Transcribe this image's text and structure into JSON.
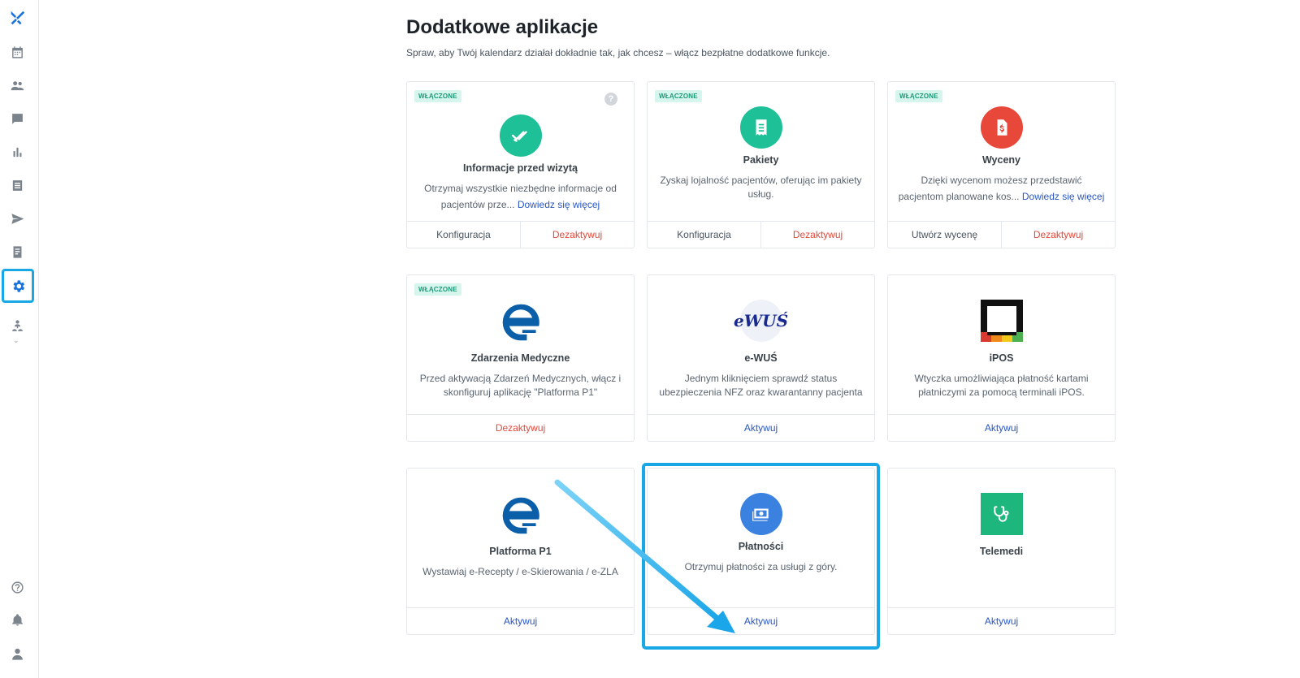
{
  "page": {
    "title": "Dodatkowe aplikacje",
    "subtitle": "Spraw, aby Twój kalendarz działał dokładnie tak, jak chcesz – włącz bezpłatne dodatkowe funkcje."
  },
  "colors": {
    "accent": "#1a73d9",
    "highlight": "#19a8e6",
    "enabled_badge": "#d6f5ec",
    "danger": "#e24a3b",
    "link": "#2a57c2"
  },
  "sidebar": {
    "items": [
      {
        "name": "logo",
        "icon": "logo-icon"
      },
      {
        "name": "calendar",
        "icon": "calendar-icon"
      },
      {
        "name": "patients",
        "icon": "people-icon"
      },
      {
        "name": "messages",
        "icon": "chat-icon"
      },
      {
        "name": "statistics",
        "icon": "bar-chart-icon"
      },
      {
        "name": "list",
        "icon": "list-icon"
      },
      {
        "name": "send",
        "icon": "send-icon"
      },
      {
        "name": "documents",
        "icon": "document-icon"
      },
      {
        "name": "settings",
        "icon": "gear-icon",
        "active": true
      },
      {
        "name": "team",
        "icon": "team-icon"
      },
      {
        "name": "help",
        "icon": "help-icon"
      },
      {
        "name": "notifications",
        "icon": "bell-icon"
      },
      {
        "name": "profile",
        "icon": "user-icon"
      }
    ]
  },
  "cards": [
    {
      "badge": "WŁĄCZONE",
      "title": "Informacje przed wizytą",
      "description": "Otrzymaj wszystkie niezbędne informacje od pacjentów prze...",
      "more": "Dowiedz się więcej",
      "actions": [
        "Konfiguracja",
        "Dezaktywuj"
      ],
      "icon": "double-check-icon",
      "help": "?"
    },
    {
      "badge": "WŁĄCZONE",
      "title": "Pakiety",
      "description": "Zyskaj lojalność pacjentów, oferując im pakiety usług.",
      "actions": [
        "Konfiguracja",
        "Dezaktywuj"
      ],
      "icon": "ticket-icon"
    },
    {
      "badge": "WŁĄCZONE",
      "title": "Wyceny",
      "description": "Dzięki wycenom możesz przedstawić pacjentom planowane kos...",
      "more": "Dowiedz się więcej",
      "actions": [
        "Utwórz wycenę",
        "Dezaktywuj"
      ],
      "icon": "dollar-document-icon"
    },
    {
      "badge": "WŁĄCZONE",
      "title": "Zdarzenia Medyczne",
      "description": "Przed aktywacją Zdarzeń Medycznych, włącz i skonfiguruj aplikację \"Platforma P1\"",
      "actions": [
        "Dezaktywuj"
      ],
      "icon": "e-logo-icon"
    },
    {
      "title": "e-WUŚ",
      "description": "Jednym kliknięciem sprawdź status ubezpieczenia NFZ oraz kwarantanny pacjenta",
      "actions": [
        "Aktywuj"
      ],
      "icon": "ewus-logo-icon",
      "logo_text": "eWUŚ"
    },
    {
      "title": "iPOS",
      "description": "Wtyczka umożliwiająca płatność kartami płatniczymi za pomocą terminali iPOS.",
      "actions": [
        "Aktywuj"
      ],
      "icon": "ipos-logo-icon"
    },
    {
      "title": "Platforma P1",
      "description": "Wystawiaj e-Recepty / e-Skierowania / e-ZLA",
      "actions": [
        "Aktywuj"
      ],
      "icon": "e-logo-icon"
    },
    {
      "title": "Płatności",
      "description": "Otrzymuj płatności za usługi z góry.",
      "actions": [
        "Aktywuj"
      ],
      "icon": "money-icon"
    },
    {
      "title": "Telemedi",
      "description": "",
      "actions": [
        "Aktywuj"
      ],
      "icon": "stethoscope-icon"
    }
  ]
}
